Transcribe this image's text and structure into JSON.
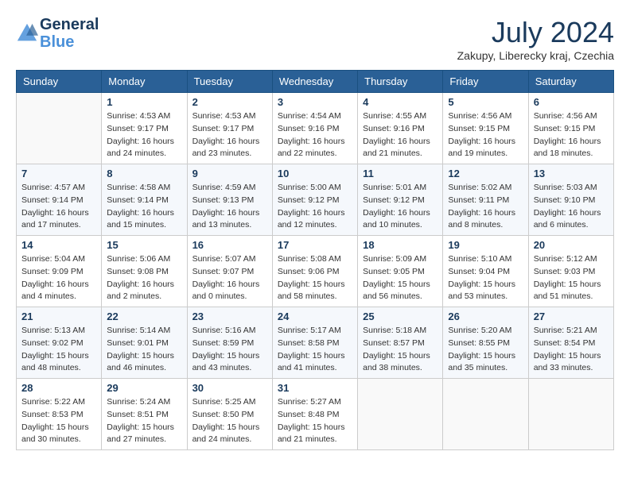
{
  "header": {
    "logo_line1": "General",
    "logo_line2": "Blue",
    "month_year": "July 2024",
    "location": "Zakupy, Liberecky kraj, Czechia"
  },
  "days_of_week": [
    "Sunday",
    "Monday",
    "Tuesday",
    "Wednesday",
    "Thursday",
    "Friday",
    "Saturday"
  ],
  "weeks": [
    [
      {
        "day": "",
        "sunrise": "",
        "sunset": "",
        "daylight": ""
      },
      {
        "day": "1",
        "sunrise": "Sunrise: 4:53 AM",
        "sunset": "Sunset: 9:17 PM",
        "daylight": "Daylight: 16 hours and 24 minutes."
      },
      {
        "day": "2",
        "sunrise": "Sunrise: 4:53 AM",
        "sunset": "Sunset: 9:17 PM",
        "daylight": "Daylight: 16 hours and 23 minutes."
      },
      {
        "day": "3",
        "sunrise": "Sunrise: 4:54 AM",
        "sunset": "Sunset: 9:16 PM",
        "daylight": "Daylight: 16 hours and 22 minutes."
      },
      {
        "day": "4",
        "sunrise": "Sunrise: 4:55 AM",
        "sunset": "Sunset: 9:16 PM",
        "daylight": "Daylight: 16 hours and 21 minutes."
      },
      {
        "day": "5",
        "sunrise": "Sunrise: 4:56 AM",
        "sunset": "Sunset: 9:15 PM",
        "daylight": "Daylight: 16 hours and 19 minutes."
      },
      {
        "day": "6",
        "sunrise": "Sunrise: 4:56 AM",
        "sunset": "Sunset: 9:15 PM",
        "daylight": "Daylight: 16 hours and 18 minutes."
      }
    ],
    [
      {
        "day": "7",
        "sunrise": "Sunrise: 4:57 AM",
        "sunset": "Sunset: 9:14 PM",
        "daylight": "Daylight: 16 hours and 17 minutes."
      },
      {
        "day": "8",
        "sunrise": "Sunrise: 4:58 AM",
        "sunset": "Sunset: 9:14 PM",
        "daylight": "Daylight: 16 hours and 15 minutes."
      },
      {
        "day": "9",
        "sunrise": "Sunrise: 4:59 AM",
        "sunset": "Sunset: 9:13 PM",
        "daylight": "Daylight: 16 hours and 13 minutes."
      },
      {
        "day": "10",
        "sunrise": "Sunrise: 5:00 AM",
        "sunset": "Sunset: 9:12 PM",
        "daylight": "Daylight: 16 hours and 12 minutes."
      },
      {
        "day": "11",
        "sunrise": "Sunrise: 5:01 AM",
        "sunset": "Sunset: 9:12 PM",
        "daylight": "Daylight: 16 hours and 10 minutes."
      },
      {
        "day": "12",
        "sunrise": "Sunrise: 5:02 AM",
        "sunset": "Sunset: 9:11 PM",
        "daylight": "Daylight: 16 hours and 8 minutes."
      },
      {
        "day": "13",
        "sunrise": "Sunrise: 5:03 AM",
        "sunset": "Sunset: 9:10 PM",
        "daylight": "Daylight: 16 hours and 6 minutes."
      }
    ],
    [
      {
        "day": "14",
        "sunrise": "Sunrise: 5:04 AM",
        "sunset": "Sunset: 9:09 PM",
        "daylight": "Daylight: 16 hours and 4 minutes."
      },
      {
        "day": "15",
        "sunrise": "Sunrise: 5:06 AM",
        "sunset": "Sunset: 9:08 PM",
        "daylight": "Daylight: 16 hours and 2 minutes."
      },
      {
        "day": "16",
        "sunrise": "Sunrise: 5:07 AM",
        "sunset": "Sunset: 9:07 PM",
        "daylight": "Daylight: 16 hours and 0 minutes."
      },
      {
        "day": "17",
        "sunrise": "Sunrise: 5:08 AM",
        "sunset": "Sunset: 9:06 PM",
        "daylight": "Daylight: 15 hours and 58 minutes."
      },
      {
        "day": "18",
        "sunrise": "Sunrise: 5:09 AM",
        "sunset": "Sunset: 9:05 PM",
        "daylight": "Daylight: 15 hours and 56 minutes."
      },
      {
        "day": "19",
        "sunrise": "Sunrise: 5:10 AM",
        "sunset": "Sunset: 9:04 PM",
        "daylight": "Daylight: 15 hours and 53 minutes."
      },
      {
        "day": "20",
        "sunrise": "Sunrise: 5:12 AM",
        "sunset": "Sunset: 9:03 PM",
        "daylight": "Daylight: 15 hours and 51 minutes."
      }
    ],
    [
      {
        "day": "21",
        "sunrise": "Sunrise: 5:13 AM",
        "sunset": "Sunset: 9:02 PM",
        "daylight": "Daylight: 15 hours and 48 minutes."
      },
      {
        "day": "22",
        "sunrise": "Sunrise: 5:14 AM",
        "sunset": "Sunset: 9:01 PM",
        "daylight": "Daylight: 15 hours and 46 minutes."
      },
      {
        "day": "23",
        "sunrise": "Sunrise: 5:16 AM",
        "sunset": "Sunset: 8:59 PM",
        "daylight": "Daylight: 15 hours and 43 minutes."
      },
      {
        "day": "24",
        "sunrise": "Sunrise: 5:17 AM",
        "sunset": "Sunset: 8:58 PM",
        "daylight": "Daylight: 15 hours and 41 minutes."
      },
      {
        "day": "25",
        "sunrise": "Sunrise: 5:18 AM",
        "sunset": "Sunset: 8:57 PM",
        "daylight": "Daylight: 15 hours and 38 minutes."
      },
      {
        "day": "26",
        "sunrise": "Sunrise: 5:20 AM",
        "sunset": "Sunset: 8:55 PM",
        "daylight": "Daylight: 15 hours and 35 minutes."
      },
      {
        "day": "27",
        "sunrise": "Sunrise: 5:21 AM",
        "sunset": "Sunset: 8:54 PM",
        "daylight": "Daylight: 15 hours and 33 minutes."
      }
    ],
    [
      {
        "day": "28",
        "sunrise": "Sunrise: 5:22 AM",
        "sunset": "Sunset: 8:53 PM",
        "daylight": "Daylight: 15 hours and 30 minutes."
      },
      {
        "day": "29",
        "sunrise": "Sunrise: 5:24 AM",
        "sunset": "Sunset: 8:51 PM",
        "daylight": "Daylight: 15 hours and 27 minutes."
      },
      {
        "day": "30",
        "sunrise": "Sunrise: 5:25 AM",
        "sunset": "Sunset: 8:50 PM",
        "daylight": "Daylight: 15 hours and 24 minutes."
      },
      {
        "day": "31",
        "sunrise": "Sunrise: 5:27 AM",
        "sunset": "Sunset: 8:48 PM",
        "daylight": "Daylight: 15 hours and 21 minutes."
      },
      {
        "day": "",
        "sunrise": "",
        "sunset": "",
        "daylight": ""
      },
      {
        "day": "",
        "sunrise": "",
        "sunset": "",
        "daylight": ""
      },
      {
        "day": "",
        "sunrise": "",
        "sunset": "",
        "daylight": ""
      }
    ]
  ]
}
